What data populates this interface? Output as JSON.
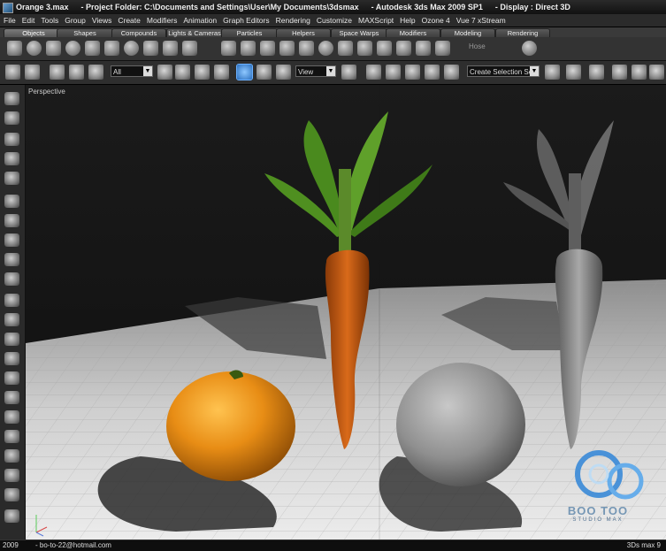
{
  "window": {
    "file_title": "Orange 3.max",
    "project_folder": "- Project Folder: C:\\Documents and Settings\\User\\My Documents\\3dsmax",
    "app_title": "- Autodesk 3ds Max  2009 SP1",
    "display": "- Display : Direct 3D"
  },
  "menu": [
    "File",
    "Edit",
    "Tools",
    "Group",
    "Views",
    "Create",
    "Modifiers",
    "Animation",
    "Graph Editors",
    "Rendering",
    "Customize",
    "MAXScript",
    "Help",
    "Ozone 4",
    "Vue 7 xStream"
  ],
  "tabs": [
    "Objects",
    "Shapes",
    "Compounds",
    "Lights & Cameras",
    "Particles",
    "Helpers",
    "Space Warps",
    "Modifiers",
    "Modeling",
    "Rendering"
  ],
  "active_tab": "Objects",
  "shelf_label": "Hose",
  "toolbar": {
    "selection_filter": "All",
    "reference_coord": "View",
    "named_selection_placeholder": "Create Selection Se"
  },
  "viewport": {
    "label": "Perspective"
  },
  "watermark": {
    "text": "BOO TOO",
    "sub": "STUDIO MAX"
  },
  "status": {
    "year": "2009",
    "email": "- bo-to-22@hotmail.com",
    "product": "3Ds max 9"
  },
  "colors": {
    "accent": "#4f9fe0",
    "floor": "#d8d8d8",
    "orange": "#e08a1a",
    "carrot": "#c75a12"
  }
}
